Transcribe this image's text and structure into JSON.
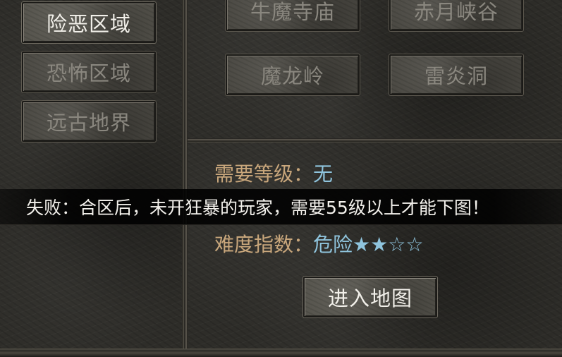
{
  "region_tabs": [
    {
      "label": "险恶区域",
      "state": "selected"
    },
    {
      "label": "恐怖区域",
      "state": "normal"
    },
    {
      "label": "远古地界",
      "state": "normal"
    }
  ],
  "maps": [
    {
      "label": "牛魔寺庙"
    },
    {
      "label": "赤月峡谷"
    },
    {
      "label": "魔龙岭"
    },
    {
      "label": "雷炎洞"
    }
  ],
  "info": {
    "level_label": "需要等级：",
    "level_value": "无",
    "difficulty_label": "难度指数：",
    "difficulty_value": "危险",
    "difficulty_stars": "★★☆☆",
    "difficulty_rating": 2,
    "difficulty_max": 4
  },
  "enter_button": {
    "label": "进入地图"
  },
  "toast": {
    "message": "失败：合区后，未开狂暴的玩家，需要55级以上才能下图！"
  },
  "colors": {
    "label": "#c9a77c",
    "value": "#8fc4dd",
    "active_text": "#f2f0ea",
    "inactive_text": "#8f8c84"
  }
}
